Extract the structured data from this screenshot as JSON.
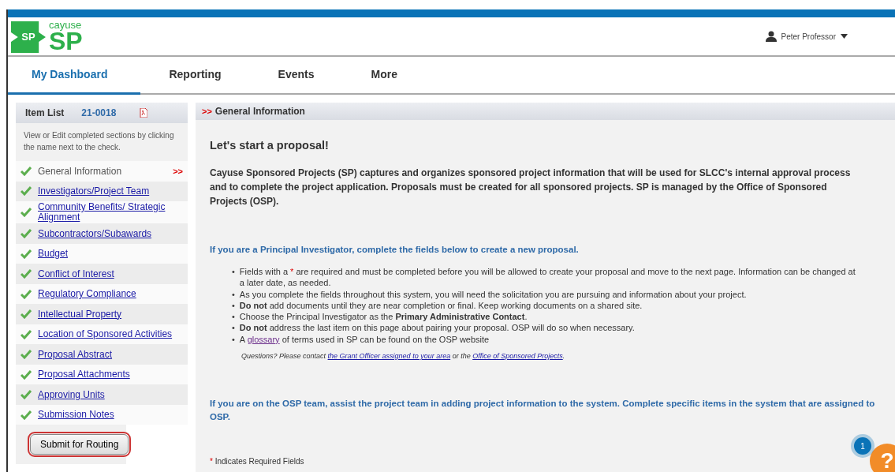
{
  "header": {
    "logo_small": "SP",
    "logo_word": "cayuse",
    "logo_big": "SP",
    "user": "Peter Professor"
  },
  "tabs": [
    {
      "label": "My Dashboard",
      "selected": true
    },
    {
      "label": "Reporting",
      "selected": false
    },
    {
      "label": "Events",
      "selected": false
    },
    {
      "label": "More",
      "selected": false
    }
  ],
  "sidebar": {
    "title": "Item List",
    "number": "21-0018",
    "hint": "View or Edit completed sections by clicking the name next to the check.",
    "items": [
      {
        "label": "General Information",
        "selected": true,
        "marker": ">>"
      },
      {
        "label": "Investigators/Project Team",
        "selected": false
      },
      {
        "label": "Community Benefits/ Strategic Alignment",
        "selected": false
      },
      {
        "label": "Subcontractors/Subawards",
        "selected": false
      },
      {
        "label": "Budget",
        "selected": false
      },
      {
        "label": "Conflict of Interest",
        "selected": false
      },
      {
        "label": "Regulatory Compliance",
        "selected": false
      },
      {
        "label": "Intellectual Property",
        "selected": false
      },
      {
        "label": "Location of Sponsored Activities",
        "selected": false
      },
      {
        "label": "Proposal Abstract",
        "selected": false
      },
      {
        "label": "Proposal Attachments",
        "selected": false
      },
      {
        "label": "Approving Units",
        "selected": false
      },
      {
        "label": "Submission Notes",
        "selected": false
      }
    ],
    "submit_button": "Submit for Routing"
  },
  "main": {
    "section_marker": ">>",
    "section_title": "General Information",
    "heading": "Let's start a proposal!",
    "intro": "Cayuse Sponsored Projects (SP) captures and organizes sponsored project information that will be used for SLCC's internal approval process and to complete the project application. Proposals must be created for all sponsored projects. SP is managed by the Office of Sponsored Projects (OSP).",
    "pi_heading": "If you are a Principal Investigator, complete the fields below to create a new proposal.",
    "bullets": [
      {
        "marker": "•",
        "parts": [
          {
            "kind": "text",
            "text": "Fields with a "
          },
          {
            "kind": "required",
            "text": "*"
          },
          {
            "kind": "text",
            "text": " are required and must be completed before you will be allowed to create your proposal and move to the next page. Information can be changed at a later date, as needed."
          }
        ]
      },
      {
        "marker": "•",
        "parts": [
          {
            "kind": "text",
            "text": "As you complete the fields throughout this system, you will need the solicitation you are pursuing and information about your project."
          }
        ]
      },
      {
        "marker": "•",
        "parts": [
          {
            "kind": "text",
            "text": "**Do not** add documents until they are near completion or final. Keep working documents on a shared site."
          }
        ]
      },
      {
        "marker": "•",
        "parts": [
          {
            "kind": "text",
            "text": "Choose the Principal Investigator as the **Primary Administrative Contact**."
          }
        ]
      },
      {
        "marker": "•",
        "parts": [
          {
            "kind": "text",
            "text": "**Do not** address the last item on this page about pairing your proposal. OSP will do so when necessary."
          }
        ]
      },
      {
        "marker": "•",
        "parts": [
          {
            "kind": "text",
            "text": "A "
          },
          {
            "kind": "visited-link",
            "text": "glossary"
          },
          {
            "kind": "text",
            "text": " of terms used in SP can be found on the OSP website"
          }
        ]
      }
    ],
    "questions": [
      {
        "kind": "text",
        "text": "Questions? Please contact "
      },
      {
        "kind": "link",
        "text": "the Grant Officer assigned to your area"
      },
      {
        "kind": "text",
        "text": " or the "
      },
      {
        "kind": "link",
        "text": "Office of Sponsored Projects"
      },
      {
        "kind": "text",
        "text": "."
      }
    ],
    "osp_heading": "If you are on the OSP team, assist the project team in adding project information to the system. Complete specific items in the system that are assigned to OSP.",
    "required_mark": "*",
    "required_note": "Indicates Required Fields"
  },
  "help": {
    "badge": "1",
    "symbol": "?"
  }
}
